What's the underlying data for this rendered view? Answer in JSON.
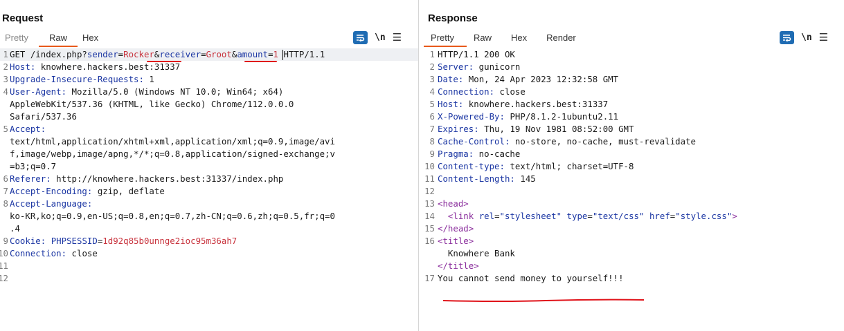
{
  "colors": {
    "accent": "#e8591b",
    "blue": "#1f6cb3",
    "keyword": "#1b36a3",
    "value": "#c8333d",
    "tag": "#8a2d9c",
    "annotation": "#e0131a"
  },
  "request": {
    "title": "Request",
    "tabs": [
      "Pretty",
      "Raw",
      "Hex"
    ],
    "active_tab": "Raw",
    "tools": {
      "wrap_icon": "wrap-lines-icon",
      "newline_label": "\\n",
      "menu_icon": "hamburger-menu-icon",
      "menu_glyph": "☰"
    },
    "lines": [
      {
        "n": "1",
        "parts": [
          {
            "t": "GET /index.php?",
            "c": ""
          },
          {
            "t": "sender",
            "c": "k"
          },
          {
            "t": "=",
            "c": ""
          },
          {
            "t": "Rocker",
            "c": "v"
          },
          {
            "t": "&",
            "c": ""
          },
          {
            "t": "receiver",
            "c": "k"
          },
          {
            "t": "=",
            "c": ""
          },
          {
            "t": "Groot",
            "c": "v"
          },
          {
            "t": "&",
            "c": ""
          },
          {
            "t": "amount",
            "c": "k"
          },
          {
            "t": "=",
            "c": ""
          },
          {
            "t": "1",
            "c": "v"
          },
          {
            "t": " HTTP/1.1",
            "c": ""
          }
        ]
      },
      {
        "n": "2",
        "parts": [
          {
            "t": "Host:",
            "c": "k"
          },
          {
            "t": " knowhere.hackers.best:31337",
            "c": ""
          }
        ]
      },
      {
        "n": "3",
        "parts": [
          {
            "t": "Upgrade-Insecure-Requests:",
            "c": "k"
          },
          {
            "t": " 1",
            "c": ""
          }
        ]
      },
      {
        "n": "4",
        "parts": [
          {
            "t": "User-Agent:",
            "c": "k"
          },
          {
            "t": " Mozilla/5.0 (Windows NT 10.0; Win64; x64)",
            "c": ""
          }
        ]
      },
      {
        "n": "",
        "parts": [
          {
            "t": "AppleWebKit/537.36 (KHTML, like Gecko) Chrome/112.0.0.0",
            "c": ""
          }
        ]
      },
      {
        "n": "",
        "parts": [
          {
            "t": "Safari/537.36",
            "c": ""
          }
        ]
      },
      {
        "n": "5",
        "parts": [
          {
            "t": "Accept:",
            "c": "k"
          }
        ]
      },
      {
        "n": "",
        "parts": [
          {
            "t": "text/html,application/xhtml+xml,application/xml;q=0.9,image/avi",
            "c": ""
          }
        ]
      },
      {
        "n": "",
        "parts": [
          {
            "t": "f,image/webp,image/apng,*/*;q=0.8,application/signed-exchange;v",
            "c": ""
          }
        ]
      },
      {
        "n": "",
        "parts": [
          {
            "t": "=b3;q=0.7",
            "c": ""
          }
        ]
      },
      {
        "n": "6",
        "parts": [
          {
            "t": "Referer:",
            "c": "k"
          },
          {
            "t": " http://knowhere.hackers.best:31337/index.php",
            "c": ""
          }
        ]
      },
      {
        "n": "7",
        "parts": [
          {
            "t": "Accept-Encoding:",
            "c": "k"
          },
          {
            "t": " gzip, deflate",
            "c": ""
          }
        ]
      },
      {
        "n": "8",
        "parts": [
          {
            "t": "Accept-Language:",
            "c": "k"
          }
        ]
      },
      {
        "n": "",
        "parts": [
          {
            "t": "ko-KR,ko;q=0.9,en-US;q=0.8,en;q=0.7,zh-CN;q=0.6,zh;q=0.5,fr;q=0",
            "c": ""
          }
        ]
      },
      {
        "n": "",
        "parts": [
          {
            "t": ".4",
            "c": ""
          }
        ]
      },
      {
        "n": "9",
        "parts": [
          {
            "t": "Cookie:",
            "c": "k"
          },
          {
            "t": " ",
            "c": ""
          },
          {
            "t": "PHPSESSID",
            "c": "k"
          },
          {
            "t": "=",
            "c": ""
          },
          {
            "t": "1d92q85b0unnge2ioc95m36ah7",
            "c": "v"
          }
        ]
      },
      {
        "n": "10",
        "parts": [
          {
            "t": "Connection:",
            "c": "k"
          },
          {
            "t": " close",
            "c": ""
          }
        ]
      },
      {
        "n": "11",
        "parts": [
          {
            "t": "",
            "c": ""
          }
        ]
      },
      {
        "n": "12",
        "parts": [
          {
            "t": "",
            "c": ""
          }
        ]
      }
    ]
  },
  "response": {
    "title": "Response",
    "tabs": [
      "Pretty",
      "Raw",
      "Hex",
      "Render"
    ],
    "active_tab": "Pretty",
    "tools": {
      "wrap_icon": "wrap-lines-icon",
      "newline_label": "\\n",
      "menu_icon": "hamburger-menu-icon",
      "menu_glyph": "☰"
    },
    "lines": [
      {
        "n": "1",
        "parts": [
          {
            "t": "HTTP/1.1 200 OK",
            "c": ""
          }
        ]
      },
      {
        "n": "2",
        "parts": [
          {
            "t": "Server:",
            "c": "k"
          },
          {
            "t": " gunicorn",
            "c": ""
          }
        ]
      },
      {
        "n": "3",
        "parts": [
          {
            "t": "Date:",
            "c": "k"
          },
          {
            "t": " Mon, 24 Apr 2023 12:32:58 GMT",
            "c": ""
          }
        ]
      },
      {
        "n": "4",
        "parts": [
          {
            "t": "Connection:",
            "c": "k"
          },
          {
            "t": " close",
            "c": ""
          }
        ]
      },
      {
        "n": "5",
        "parts": [
          {
            "t": "Host:",
            "c": "k"
          },
          {
            "t": " knowhere.hackers.best:31337",
            "c": ""
          }
        ]
      },
      {
        "n": "6",
        "parts": [
          {
            "t": "X-Powered-By:",
            "c": "k"
          },
          {
            "t": " PHP/8.1.2-1ubuntu2.11",
            "c": ""
          }
        ]
      },
      {
        "n": "7",
        "parts": [
          {
            "t": "Expires:",
            "c": "k"
          },
          {
            "t": " Thu, 19 Nov 1981 08:52:00 GMT",
            "c": ""
          }
        ]
      },
      {
        "n": "8",
        "parts": [
          {
            "t": "Cache-Control:",
            "c": "k"
          },
          {
            "t": " no-store, no-cache, must-revalidate",
            "c": ""
          }
        ]
      },
      {
        "n": "9",
        "parts": [
          {
            "t": "Pragma:",
            "c": "k"
          },
          {
            "t": " no-cache",
            "c": ""
          }
        ]
      },
      {
        "n": "10",
        "parts": [
          {
            "t": "Content-type:",
            "c": "k"
          },
          {
            "t": " text/html; charset=UTF-8",
            "c": ""
          }
        ]
      },
      {
        "n": "11",
        "parts": [
          {
            "t": "Content-Length:",
            "c": "k"
          },
          {
            "t": " 145",
            "c": ""
          }
        ]
      },
      {
        "n": "12",
        "parts": [
          {
            "t": "",
            "c": ""
          }
        ]
      },
      {
        "n": "13",
        "parts": [
          {
            "t": "<head>",
            "c": "tag"
          }
        ]
      },
      {
        "n": "14",
        "parts": [
          {
            "t": "  <link ",
            "c": "tag"
          },
          {
            "t": "rel",
            "c": "attr"
          },
          {
            "t": "=",
            "c": ""
          },
          {
            "t": "\"stylesheet\"",
            "c": "str"
          },
          {
            "t": " ",
            "c": ""
          },
          {
            "t": "type",
            "c": "attr"
          },
          {
            "t": "=",
            "c": ""
          },
          {
            "t": "\"text/css\"",
            "c": "str"
          },
          {
            "t": " ",
            "c": ""
          },
          {
            "t": "href",
            "c": "attr"
          },
          {
            "t": "=",
            "c": ""
          },
          {
            "t": "\"style.css\"",
            "c": "str"
          },
          {
            "t": ">",
            "c": "tag"
          }
        ]
      },
      {
        "n": "",
        "parts": [
          {
            "t": "",
            "c": ""
          }
        ]
      },
      {
        "n": "15",
        "parts": [
          {
            "t": "</head>",
            "c": "tag"
          }
        ]
      },
      {
        "n": "16",
        "parts": [
          {
            "t": "<title>",
            "c": "tag"
          }
        ]
      },
      {
        "n": "",
        "parts": [
          {
            "t": "  Knowhere Bank",
            "c": ""
          }
        ]
      },
      {
        "n": "",
        "parts": [
          {
            "t": "</title>",
            "c": "tag"
          }
        ]
      },
      {
        "n": "17",
        "parts": [
          {
            "t": "You cannot send money to yourself!!!",
            "c": ""
          }
        ]
      }
    ]
  }
}
